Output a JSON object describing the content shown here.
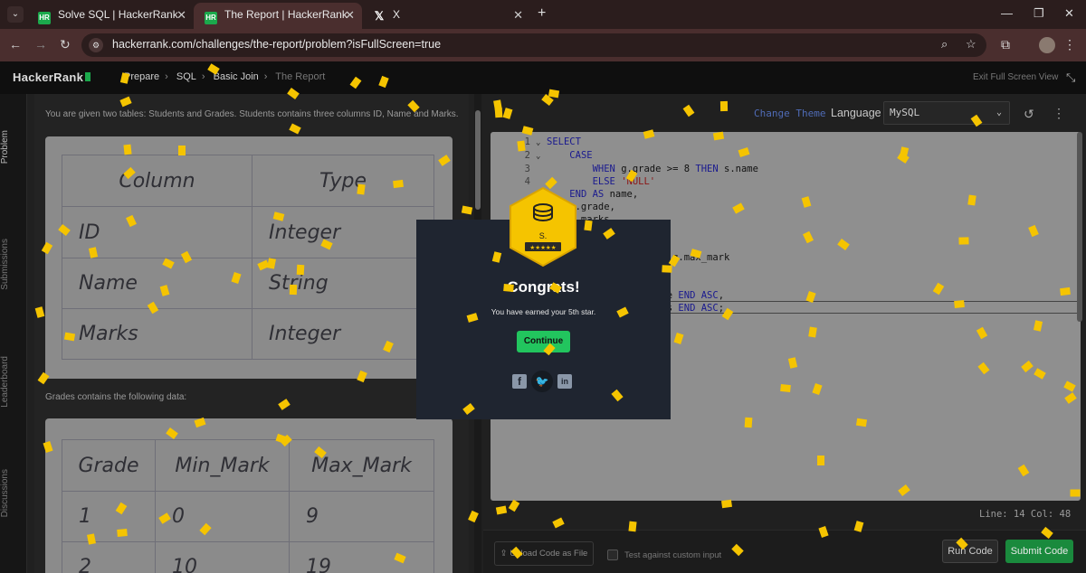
{
  "browser": {
    "tabs": [
      {
        "favicon": "HR",
        "title": "Solve SQL | HackerRank",
        "active": false
      },
      {
        "favicon": "HR",
        "title": "The Report | HackerRank",
        "active": true
      },
      {
        "favicon": "X",
        "title": "X",
        "active": false
      }
    ],
    "url": "hackerrank.com/challenges/the-report/problem?isFullScreen=true",
    "new_tab": "+",
    "close_glyph": "✕"
  },
  "header": {
    "logo": "HackerRank",
    "breadcrumb": [
      "Prepare",
      "SQL",
      "Basic Join",
      "The Report"
    ],
    "exit_fullscreen": "Exit Full Screen View"
  },
  "sidenav": [
    "Problem",
    "Submissions",
    "Leaderboard",
    "Discussions"
  ],
  "problem": {
    "intro": "You are given two tables: Students and Grades. Students contains three columns ID, Name and Marks.",
    "students_table": {
      "headers": [
        "Column",
        "Type"
      ],
      "rows": [
        [
          "ID",
          "Integer"
        ],
        [
          "Name",
          "String"
        ],
        [
          "Marks",
          "Integer"
        ]
      ]
    },
    "grades_intro": "Grades contains the following data:",
    "grades_table": {
      "headers": [
        "Grade",
        "Min_Mark",
        "Max_Mark"
      ],
      "rows": [
        [
          "1",
          "0",
          "9"
        ],
        [
          "2",
          "10",
          "19"
        ]
      ]
    }
  },
  "editor": {
    "change_theme": "Change Theme",
    "language_label": "Language",
    "language": "MySQL",
    "status": "Line: 14 Col: 48",
    "upload": "Upload Code as File",
    "test_custom": "Test against custom input",
    "run": "Run Code",
    "submit": "Submit Code",
    "lines": [
      {
        "n": "1",
        "fold": true,
        "text": "SELECT"
      },
      {
        "n": "2",
        "fold": true,
        "text": "    CASE"
      },
      {
        "n": "3",
        "fold": false,
        "text": "        WHEN g.grade >= 8 THEN s.name"
      },
      {
        "n": "4",
        "fold": false,
        "text": "        ELSE 'NULL'"
      },
      {
        "n": "",
        "fold": false,
        "text": "    END AS name,"
      },
      {
        "n": "",
        "fold": false,
        "text": "    g.grade,"
      },
      {
        "n": "",
        "fold": false,
        "text": "    s.marks"
      },
      {
        "n": "",
        "fold": false,
        "text": ""
      },
      {
        "n": "",
        "fold": false,
        "text": ""
      },
      {
        "n": "",
        "fold": false,
        "text": "    EN g.min_mark AND g.max_mark"
      },
      {
        "n": "",
        "fold": false,
        "text": ""
      },
      {
        "n": "",
        "fold": false,
        "text": ""
      },
      {
        "n": "",
        "fold": false,
        "text": "    e >= 8 THEN s.name END ASC,"
      },
      {
        "n": "",
        "fold": false,
        "text": "    e < 8 THEN s.marks END ASC;"
      }
    ]
  },
  "modal": {
    "badge_text": "S.",
    "badge_stars": "★★★★★",
    "title": "Congrats!",
    "message": "You have earned your 5th star.",
    "continue": "Continue"
  },
  "colors": {
    "confetti": "#f5c400",
    "brand_green": "#1ba94c"
  }
}
